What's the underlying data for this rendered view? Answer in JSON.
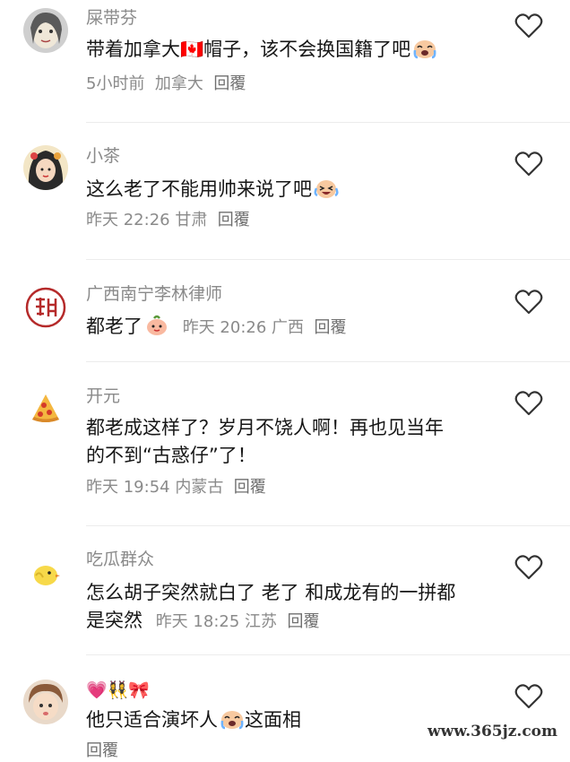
{
  "comments": [
    {
      "username": "屎带芬",
      "text": "带着加拿大🇨🇦帽子，该不会换国籍了吧",
      "time": "5小时前",
      "location": "加拿大",
      "reply": "回覆",
      "avatar_icon": "woman-portrait-icon",
      "emoji_icon": "crying-face-icon"
    },
    {
      "username": "小茶",
      "text": "这么老了不能用帅来说了吧",
      "time": "昨天 22:26",
      "location": "甘肃",
      "reply": "回覆",
      "avatar_icon": "anime-girl-icon",
      "emoji_icon": "laughing-tears-icon"
    },
    {
      "username": "广西南宁李林律师",
      "text": "都老了",
      "time": "昨天 20:26",
      "location": "广西",
      "reply": "回覆",
      "avatar_icon": "red-seal-icon",
      "emoji_icon": "peach-face-icon"
    },
    {
      "username": "开元",
      "text_line1": "都老成这样了？岁月不饶人啊！再也见当年",
      "text_line2": "的不到“古惑仔”了！",
      "time": "昨天 19:54",
      "location": "内蒙古",
      "reply": "回覆",
      "avatar_icon": "pizza-slice-icon"
    },
    {
      "username": "吃瓜群众",
      "text_line1": "怎么胡子突然就白了 老了 和成龙有的一拼都",
      "text_line2": "是突然",
      "time": "昨天 18:25",
      "location": "江苏",
      "reply": "回覆",
      "avatar_icon": "chick-icon"
    },
    {
      "username": "💗👯‍♀️🎀",
      "text": "他只适合演坏人",
      "text_after": "这面相",
      "reply": "回覆",
      "avatar_icon": "child-photo-icon",
      "emoji_icon": "crying-face-icon"
    }
  ],
  "watermark": "www.365jz.com",
  "colors": {
    "username": "#8a8a8a",
    "text": "#161616",
    "divider": "#ececec",
    "heart_stroke": "#333333"
  }
}
